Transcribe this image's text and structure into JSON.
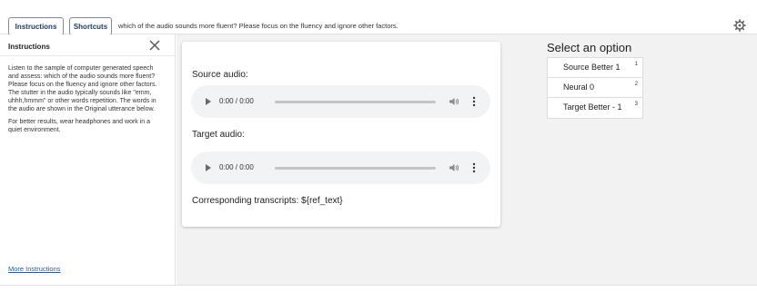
{
  "toolbar": {
    "instructions_label": "Instructions",
    "shortcuts_label": "Shortcuts",
    "question": "which of the audio sounds more fluent? Please focus on the fluency and ignore other factors.",
    "settings_icon": "gear-icon"
  },
  "instructions_panel": {
    "title": "Instructions",
    "close_icon": "close-icon",
    "paragraph_1": "Listen to the sample of computer generated speech and assess: which of the audio sounds more fluent? Please focus on the fluency and ignore other factors. The stutter in the audio typically sounds like \"emm, uhhh,hmmm\" or other words repetition. The words in the audio are shown in the Original utterance below.",
    "paragraph_2": "For better results, wear headphones and work in a quiet environment.",
    "more_link": "More Instructions"
  },
  "card": {
    "source_label": "Source audio:",
    "source_time": "0:00 / 0:00",
    "target_label": "Target audio:",
    "target_time": "0:00 / 0:00",
    "transcript_label": "Corresponding transcripts: ${ref_text}"
  },
  "options": {
    "title": "Select an option",
    "items": [
      {
        "label": "Source Better 1",
        "key": "1"
      },
      {
        "label": "Neural 0",
        "key": "2"
      },
      {
        "label": "Target Better - 1",
        "key": "3"
      }
    ]
  },
  "colors": {
    "link": "#1a5fb4",
    "main_background": "#f2f2f2",
    "player_background": "#f1f3f4"
  }
}
